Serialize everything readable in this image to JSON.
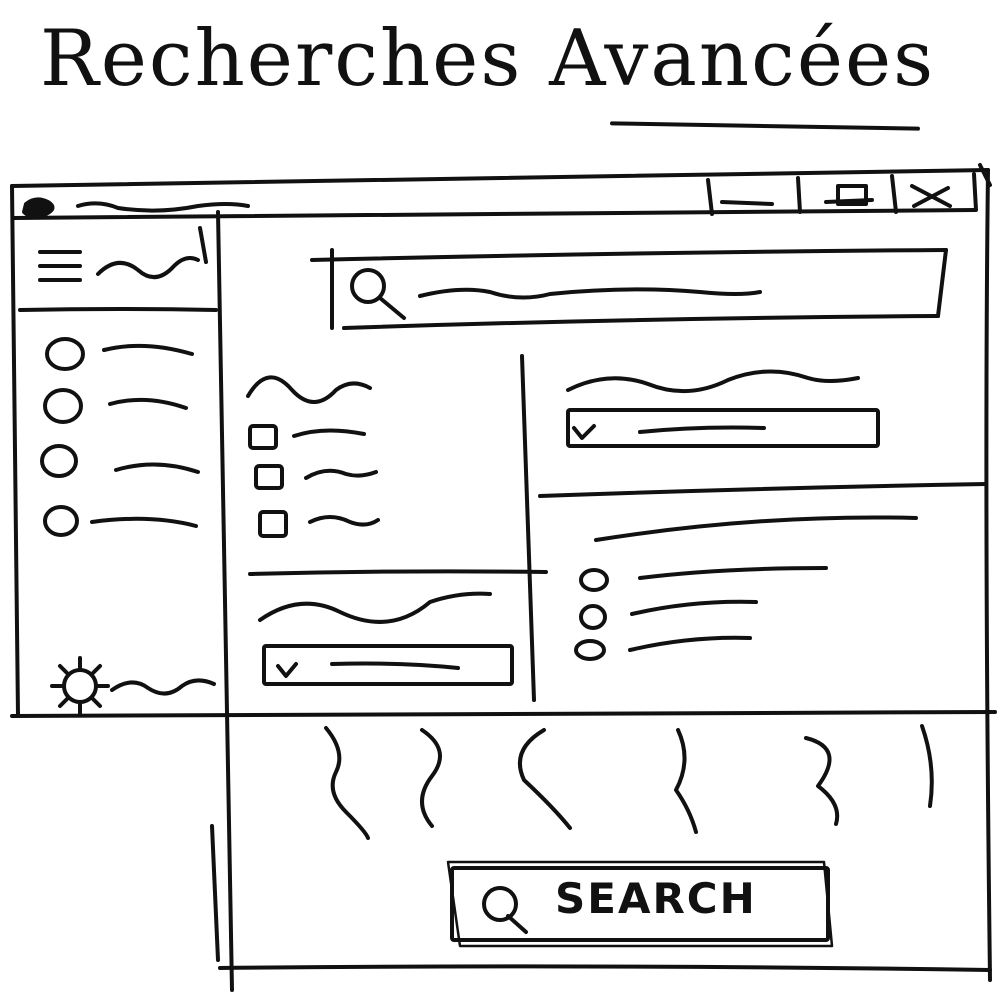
{
  "page": {
    "title": "Recherches Avancées"
  },
  "window": {
    "controls": [
      "minimize-icon",
      "maximize-icon",
      "close-icon"
    ]
  },
  "sidebar": {
    "items": [
      {
        "icon": "circle-icon"
      },
      {
        "icon": "circle-icon"
      },
      {
        "icon": "circle-icon"
      },
      {
        "icon": "circle-icon"
      }
    ],
    "footer_icon": "gear-icon"
  },
  "filters": {
    "checkbox_group": {
      "count": 3
    },
    "select_left": {
      "checked": true
    },
    "select_right": {
      "checked": true
    },
    "radio_group": {
      "count": 3
    }
  },
  "results": {
    "column_count": 6
  },
  "actions": {
    "search_label": "SEARCH",
    "search_icon": "search-icon"
  },
  "colors": {
    "ink": "#111111",
    "paper": "#ffffff"
  }
}
